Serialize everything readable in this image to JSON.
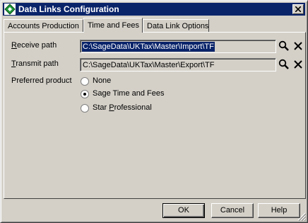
{
  "window": {
    "title": "Data Links Configuration"
  },
  "tabs": [
    {
      "label": "Accounts Production"
    },
    {
      "label": "Time and Fees",
      "active": true
    },
    {
      "label": "Data Link Options"
    }
  ],
  "form": {
    "receive": {
      "label": "Receive path",
      "mnemonic": "R",
      "label_rest": "eceive path",
      "value": "C:\\SageData\\UKTax\\Master\\Import\\TF"
    },
    "transmit": {
      "label": "Transmit path",
      "mnemonic": "T",
      "label_rest": "ransmit path",
      "value": "C:\\SageData\\UKTax\\Master\\Export\\TF"
    },
    "preferred_label": "Preferred product",
    "options": [
      {
        "label": "None",
        "checked": false
      },
      {
        "label": "Sage Time and Fees",
        "checked": true
      },
      {
        "label": "Star Professional",
        "label_pre": "Star ",
        "mnemonic": "P",
        "label_post": "rofessional",
        "checked": false
      }
    ]
  },
  "buttons": {
    "ok": "OK",
    "cancel": "Cancel",
    "help": "Help"
  },
  "icons": [
    "app-diamond-icon",
    "close-icon",
    "search-icon",
    "clear-icon",
    "size-grip-icon"
  ],
  "colors": {
    "titlebar": "#0a246a",
    "face": "#d4d0c8",
    "selection": "#0a246a",
    "app_icon": "#1f9b3a"
  }
}
